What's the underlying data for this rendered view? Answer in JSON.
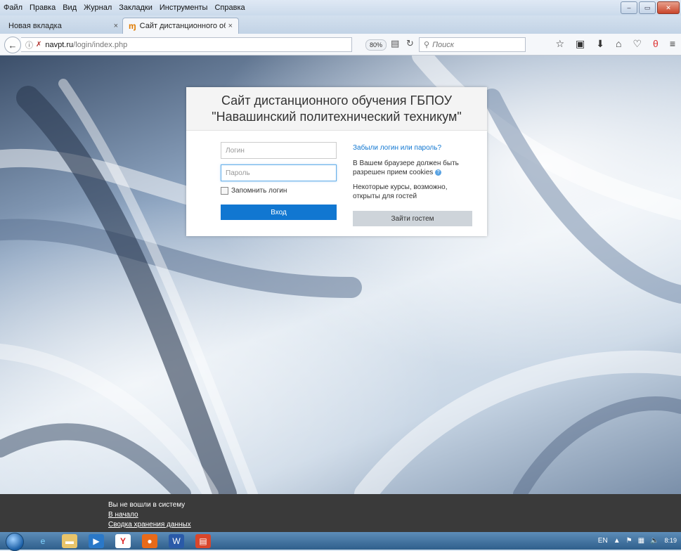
{
  "menu": [
    "Файл",
    "Правка",
    "Вид",
    "Журнал",
    "Закладки",
    "Инструменты",
    "Справка"
  ],
  "window_controls": {
    "minimize": "–",
    "maximize": "▭",
    "close": "✕"
  },
  "tabs": [
    {
      "label": "Новая вкладка",
      "active": false,
      "close": "×"
    },
    {
      "label": "Сайт дистанционного обу...",
      "active": true,
      "close": "×"
    }
  ],
  "new_tab_label": "+",
  "url": {
    "host": "navpt.ru",
    "path": "/login/index.php"
  },
  "zoom": "80%",
  "search_placeholder": "Поиск",
  "login": {
    "title_line1": "Сайт дистанционного обучения ГБПОУ",
    "title_line2": "\"Навашинский политехнический техникум\"",
    "username_placeholder": "Логин",
    "password_placeholder": "Пароль",
    "remember_label": "Запомнить логин",
    "login_button": "Вход",
    "forgot_link": "Забыли логин или пароль?",
    "cookies_text": "В Вашем браузере должен быть разрешен прием cookies",
    "guest_note": "Некоторые курсы, возможно, открыты для гостей",
    "guest_button": "Зайти гостем"
  },
  "footer": {
    "status": "Вы не вошли в систему",
    "home_link": "В начало",
    "data_link": "Сводка хранения данных"
  },
  "taskbar": {
    "language": "EN",
    "time": "8:19"
  },
  "colors": {
    "primary_button": "#1177d1",
    "guest_button": "#ced4da",
    "footer_bg": "#3a3a3a"
  }
}
